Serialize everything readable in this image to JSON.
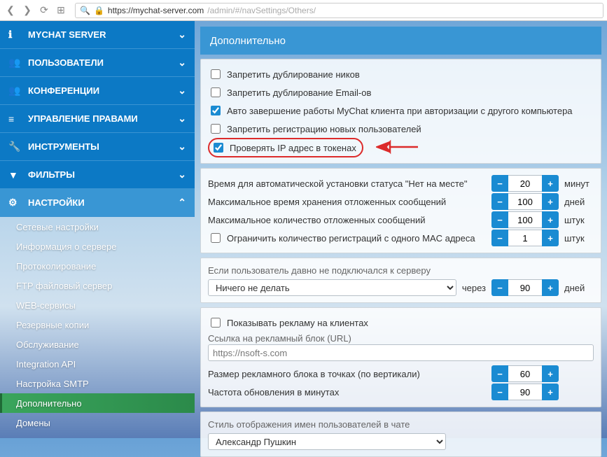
{
  "browser": {
    "url_secure_host": "https://mychat-server.com",
    "url_path": "/admin/#/navSettings/Others/"
  },
  "sidebar": {
    "items": [
      {
        "label": "MYCHAT SERVER",
        "icon": "ℹ"
      },
      {
        "label": "ПОЛЬЗОВАТЕЛИ",
        "icon": "👥"
      },
      {
        "label": "КОНФЕРЕНЦИИ",
        "icon": "👥"
      },
      {
        "label": "УПРАВЛЕНИЕ ПРАВАМИ",
        "icon": "≡"
      },
      {
        "label": "ИНСТРУМЕНТЫ",
        "icon": "🔧"
      },
      {
        "label": "ФИЛЬТРЫ",
        "icon": "▼"
      },
      {
        "label": "НАСТРОЙКИ",
        "icon": "⚙"
      }
    ],
    "subitems": [
      "Сетевые настройки",
      "Информация о сервере",
      "Протоколирование",
      "FTP файловый сервер",
      "WEB-сервисы",
      "Резервные копии",
      "Обслуживание",
      "Integration API",
      "Настройка SMTP",
      "Дополнительно",
      "Домены"
    ]
  },
  "main": {
    "title": "Дополнительно",
    "checks": {
      "dup_nick": "Запретить дублирование ников",
      "dup_email": "Запретить дублирование Email-ов",
      "autologout": "Авто завершение работы MyChat клиента при авторизации с другого компьютера",
      "noreg": "Запретить регистрацию новых пользователей",
      "checkip": "Проверять IP адрес в токенах"
    },
    "p2": {
      "away_label": "Время для автоматической установки статуса \"Нет на месте\"",
      "away_val": "20",
      "away_unit": "минут",
      "offmsg_time_label": "Максимальное время хранения отложенных сообщений",
      "offmsg_time_val": "100",
      "offmsg_time_unit": "дней",
      "offmsg_cnt_label": "Максимальное количество отложенных сообщений",
      "offmsg_cnt_val": "100",
      "offmsg_cnt_unit": "штук",
      "mac_label": "Ограничить количество регистраций с одного MAC адреса",
      "mac_val": "1",
      "mac_unit": "штук"
    },
    "p3": {
      "label": "Если пользователь давно не подключался к серверу",
      "select": "Ничего не делать",
      "through": "через",
      "val": "90",
      "unit": "дней"
    },
    "p4": {
      "show_ad": "Показывать рекламу на клиентах",
      "url_label": "Ссылка на рекламный блок (URL)",
      "url_val": "https://nsoft-s.com",
      "size_label": "Размер рекламного блока в точках (по вертикали)",
      "size_val": "60",
      "freq_label": "Частота обновления в минутах",
      "freq_val": "90"
    },
    "p5": {
      "label": "Стиль отображения имен пользователей в чате",
      "select": "Александр Пушкин"
    }
  }
}
